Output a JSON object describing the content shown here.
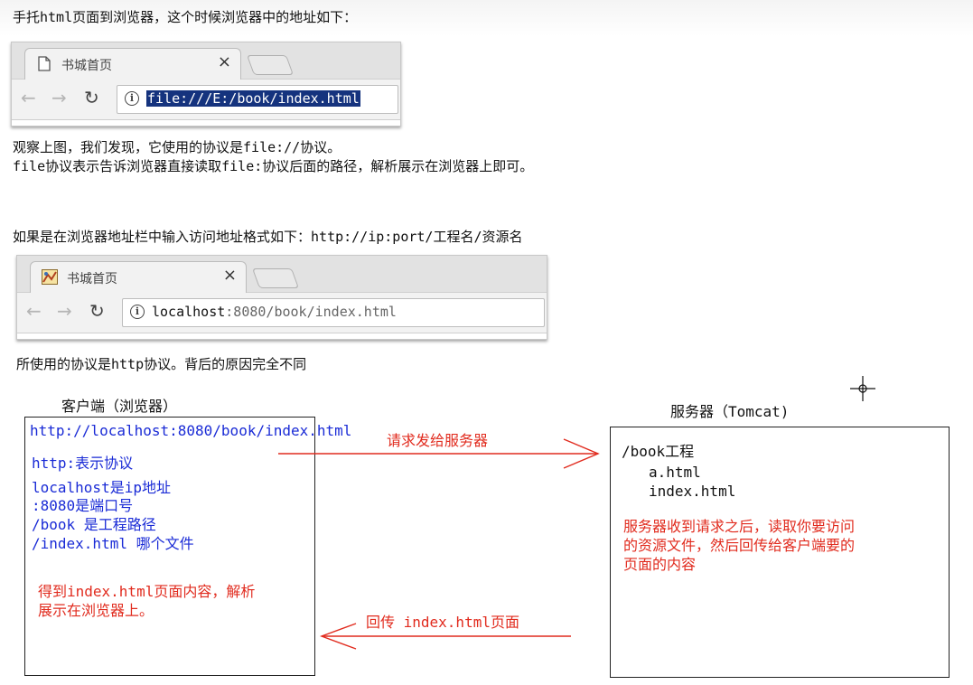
{
  "intro": {
    "line1": "手托html页面到浏览器，这个时候浏览器中的地址如下：",
    "observe1": "观察上图，我们发现，它使用的协议是file://协议。",
    "observe2": "file协议表示告诉浏览器直接读取file:协议后面的路径，解析展示在浏览器上即可。",
    "format": "如果是在浏览器地址栏中输入访问地址格式如下：http://ip:port/工程名/资源名",
    "http_note": "所使用的协议是http协议。背后的原因完全不同"
  },
  "browser1": {
    "tab_title": "书城首页",
    "tab_close": "×",
    "url": "file:///E:/book/index.html",
    "icons": [
      "page-icon",
      "back-arrow-icon",
      "forward-arrow-icon",
      "reload-icon",
      "info-icon"
    ]
  },
  "browser2": {
    "tab_title": "书城首页",
    "tab_close": "×",
    "url_host": "localhost",
    "url_rest": ":8080/book/index.html",
    "icons": [
      "favicon-icon",
      "back-arrow-icon",
      "forward-arrow-icon",
      "reload-icon",
      "info-icon"
    ]
  },
  "client": {
    "title": "客户端（浏览器）",
    "url": "http://localhost:8080/book/index.html",
    "notes": [
      "http:表示协议",
      "localhost是ip地址",
      ":8080是端口号",
      "/book 是工程路径",
      "/index.html 哪个文件"
    ],
    "result1": "得到index.html页面内容，解析",
    "result2": "展示在浏览器上。"
  },
  "server": {
    "title": "服务器（Tomcat)",
    "project": "/book工程",
    "files": [
      "a.html",
      "index.html"
    ],
    "desc1": "服务器收到请求之后，读取你要访问",
    "desc2": "的资源文件，然后回传给客户端要的",
    "desc3": "页面的内容"
  },
  "arrows": {
    "request_label": "请求发给服务器",
    "response_label": "回传 index.html页面"
  },
  "colors": {
    "blue_text": "#1a2bd6",
    "red_text": "#e12b1e",
    "url_selection": "#15337e"
  }
}
